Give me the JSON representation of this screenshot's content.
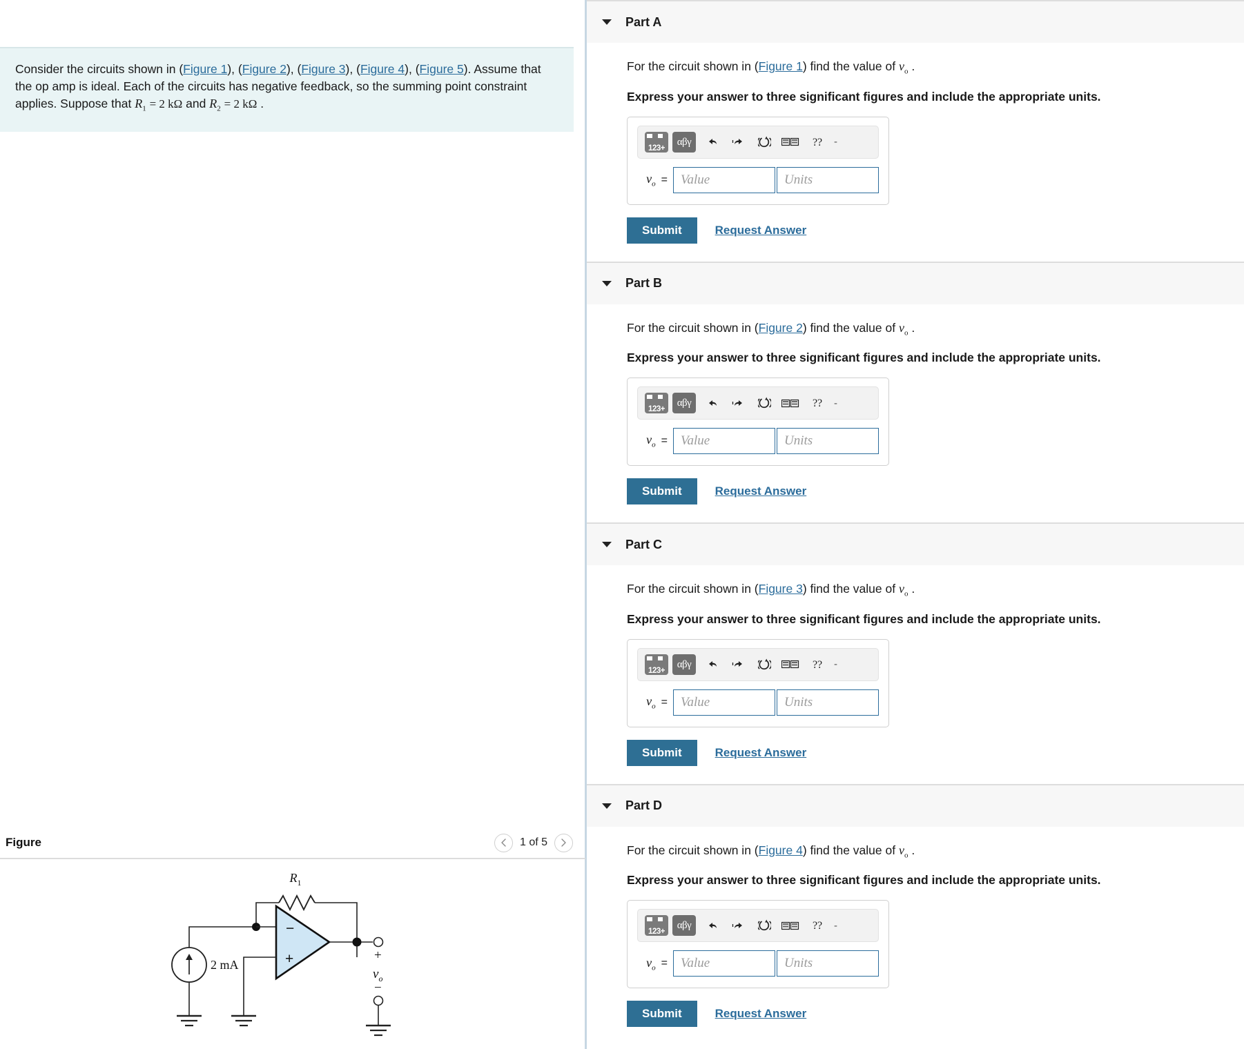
{
  "problem": {
    "intro_1": "Consider the circuits shown in (",
    "fig_links": [
      "Figure 1",
      "Figure 2",
      "Figure 3",
      "Figure 4",
      "Figure 5"
    ],
    "intro_2": "). Assume that the op amp is ideal. Each of the circuits has negative feedback, so the summing point constraint applies. Suppose that ",
    "r1_symbol": "R",
    "r1_sub": "1",
    "r1_value": "= 2 kΩ",
    "conjunction": "and",
    "r2_symbol": "R",
    "r2_sub": "2",
    "r2_value": "= 2 kΩ",
    "period": ".",
    "background_color": "#e9f4f5"
  },
  "figure": {
    "title": "Figure",
    "pager_label": "1 of 5",
    "prev_icon": "chevron-left-icon",
    "next_icon": "chevron-right-icon",
    "circuit": {
      "resistor_label": "R",
      "resistor_sub": "1",
      "source_label": "2 mA",
      "opamp_minus": "−",
      "opamp_plus": "+",
      "out_plus": "+",
      "out_minus": "−",
      "out_label": "v",
      "out_label_sub": "o",
      "opamp_fill": "#cfe6f5"
    }
  },
  "toolbar": {
    "keypad_tile_label": "123+",
    "greek_tile_label": "αβγ",
    "icons": [
      {
        "name": "undo-icon",
        "title": "Undo"
      },
      {
        "name": "redo-icon",
        "title": "Redo"
      },
      {
        "name": "reset-icon",
        "title": "Reset"
      },
      {
        "name": "keyboard-shortcuts-icon",
        "title": "Keyboard Shortcuts"
      },
      {
        "name": "help-icon",
        "title": "Help"
      }
    ],
    "dash": "-"
  },
  "answer_field": {
    "label": "v",
    "label_sub": "o",
    "equals": "=",
    "value_placeholder": "Value",
    "units_placeholder": "Units",
    "value": "",
    "units": "",
    "border_color": "#2b6c9b"
  },
  "actions": {
    "submit_label": "Submit",
    "request_answer_label": "Request Answer",
    "submit_color": "#2e6f94",
    "link_color": "#2b6c9b"
  },
  "parts": [
    {
      "id": "a",
      "title": "Part A",
      "prompt_before": "For the circuit shown in (",
      "figure_link": "Figure 1",
      "prompt_after": ") find the value of ",
      "prompt_var": "v",
      "prompt_var_sub": "o",
      "prompt_end": ".",
      "instruction": "Express your answer to three significant figures and include the appropriate units."
    },
    {
      "id": "b",
      "title": "Part B",
      "prompt_before": "For the circuit shown in (",
      "figure_link": "Figure 2",
      "prompt_after": ") find the value of ",
      "prompt_var": "v",
      "prompt_var_sub": "o",
      "prompt_end": ".",
      "instruction": "Express your answer to three significant figures and include the appropriate units."
    },
    {
      "id": "c",
      "title": "Part C",
      "prompt_before": "For the circuit shown in (",
      "figure_link": "Figure 3",
      "prompt_after": ") find the value of ",
      "prompt_var": "v",
      "prompt_var_sub": "o",
      "prompt_end": ".",
      "instruction": "Express your answer to three significant figures and include the appropriate units."
    },
    {
      "id": "d",
      "title": "Part D",
      "prompt_before": "For the circuit shown in (",
      "figure_link": "Figure 4",
      "prompt_after": ") find the value of ",
      "prompt_var": "v",
      "prompt_var_sub": "o",
      "prompt_end": ".",
      "instruction": "Express your answer to three significant figures and include the appropriate units."
    }
  ]
}
